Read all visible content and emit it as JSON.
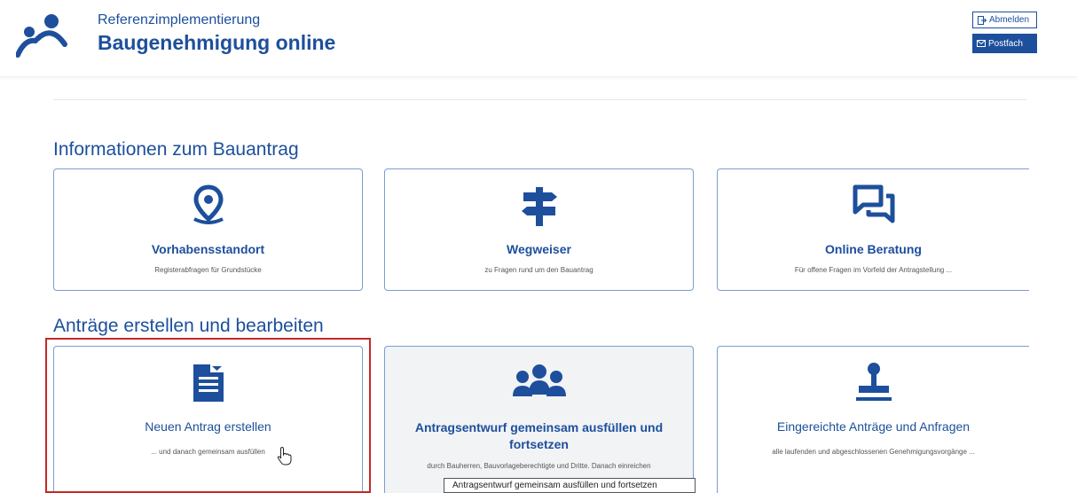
{
  "header": {
    "subtitle": "Referenzimplementierung",
    "title": "Baugenehmigung online",
    "logout_label": "Abmelden",
    "inbox_label": "Postfach"
  },
  "sections": [
    {
      "title": "Informationen zum Bauantrag",
      "cards": [
        {
          "icon": "location-pin-icon",
          "title": "Vorhabensstandort",
          "desc": "Registerabfragen für Grundstücke"
        },
        {
          "icon": "signpost-icon",
          "title": "Wegweiser",
          "desc": "zu Fragen rund um den Bauantrag"
        },
        {
          "icon": "chat-bubbles-icon",
          "title": "Online Beratung",
          "desc": "Für offene Fragen im Vorfeld der Antragstellung ..."
        }
      ]
    },
    {
      "title": "Anträge erstellen und bearbeiten",
      "cards": [
        {
          "icon": "form-document-icon",
          "title": "Neuen Antrag erstellen",
          "desc": "... und danach gemeinsam ausfüllen"
        },
        {
          "icon": "group-icon",
          "title": "Antragsentwurf gemeinsam ausfüllen und fortsetzen",
          "desc": "durch Bauherren, Bauvorlageberechtigte und Dritte. Danach einreichen"
        },
        {
          "icon": "stamp-icon",
          "title": "Eingereichte Anträge und Anfragen",
          "desc": "alle laufenden und abgeschlossenen Genehmigungsvorgänge ..."
        }
      ]
    }
  ],
  "tooltip": "Antragsentwurf gemeinsam ausfüllen und fortsetzen",
  "colors": {
    "primary": "#1d4f9c",
    "border": "#7a9ed0",
    "highlight": "#c62828"
  }
}
